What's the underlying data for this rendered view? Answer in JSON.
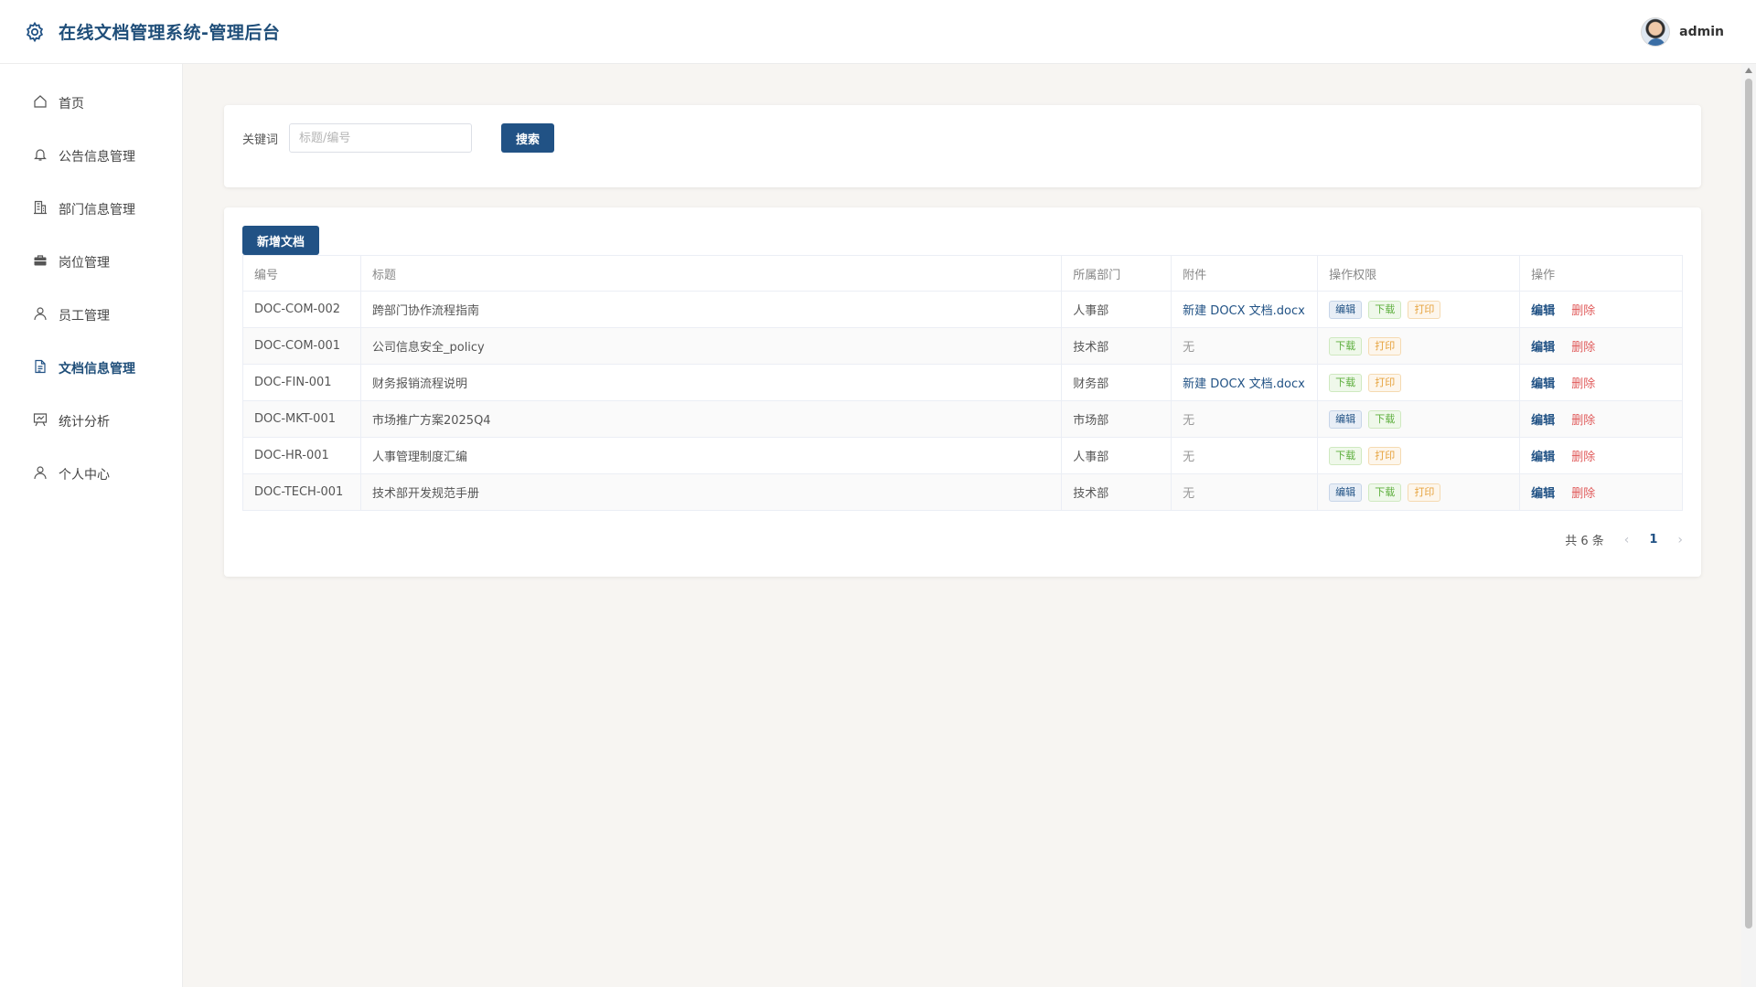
{
  "app": {
    "title": "在线文档管理系统-管理后台",
    "brand_icon": "gear-icon"
  },
  "user": {
    "name": "admin"
  },
  "sidebar": {
    "items": [
      {
        "label": "首页",
        "icon": "home-icon",
        "active": false
      },
      {
        "label": "公告信息管理",
        "icon": "bell-icon",
        "active": false
      },
      {
        "label": "部门信息管理",
        "icon": "building-icon",
        "active": false
      },
      {
        "label": "岗位管理",
        "icon": "briefcase-icon",
        "active": false
      },
      {
        "label": "员工管理",
        "icon": "user-icon",
        "active": false
      },
      {
        "label": "文档信息管理",
        "icon": "document-icon",
        "active": true
      },
      {
        "label": "统计分析",
        "icon": "chart-board-icon",
        "active": false
      },
      {
        "label": "个人中心",
        "icon": "user-icon",
        "active": false
      }
    ]
  },
  "search": {
    "label": "关键词",
    "placeholder": "标题/编号",
    "value": "",
    "button": "搜索"
  },
  "toolbar": {
    "add_label": "新增文档"
  },
  "table": {
    "headers": [
      "编号",
      "标题",
      "所属部门",
      "附件",
      "操作权限",
      "操作"
    ],
    "rows": [
      {
        "code": "DOC-COM-002",
        "title": "跨部门协作流程指南",
        "dept": "人事部",
        "attachment": "新建 DOCX 文档.docx",
        "perms": [
          "编辑",
          "下载",
          "打印"
        ]
      },
      {
        "code": "DOC-COM-001",
        "title": "公司信息安全_policy",
        "dept": "技术部",
        "attachment": "无",
        "perms": [
          "下载",
          "打印"
        ]
      },
      {
        "code": "DOC-FIN-001",
        "title": "财务报销流程说明",
        "dept": "财务部",
        "attachment": "新建 DOCX 文档.docx",
        "perms": [
          "下载",
          "打印"
        ]
      },
      {
        "code": "DOC-MKT-001",
        "title": "市场推广方案2025Q4",
        "dept": "市场部",
        "attachment": "无",
        "perms": [
          "编辑",
          "下载"
        ]
      },
      {
        "code": "DOC-HR-001",
        "title": "人事管理制度汇编",
        "dept": "人事部",
        "attachment": "无",
        "perms": [
          "下载",
          "打印"
        ]
      },
      {
        "code": "DOC-TECH-001",
        "title": "技术部开发规范手册",
        "dept": "技术部",
        "attachment": "无",
        "perms": [
          "编辑",
          "下载",
          "打印"
        ]
      }
    ],
    "actions": {
      "edit": "编辑",
      "delete": "删除"
    }
  },
  "pagination": {
    "total_text": "共 6 条",
    "current_page": "1",
    "prev": "‹",
    "next": "›"
  },
  "colors": {
    "primary": "#215285",
    "download_tag": "#5cae3c",
    "print_tag": "#e6a23c",
    "delete": "#e05a5a"
  }
}
